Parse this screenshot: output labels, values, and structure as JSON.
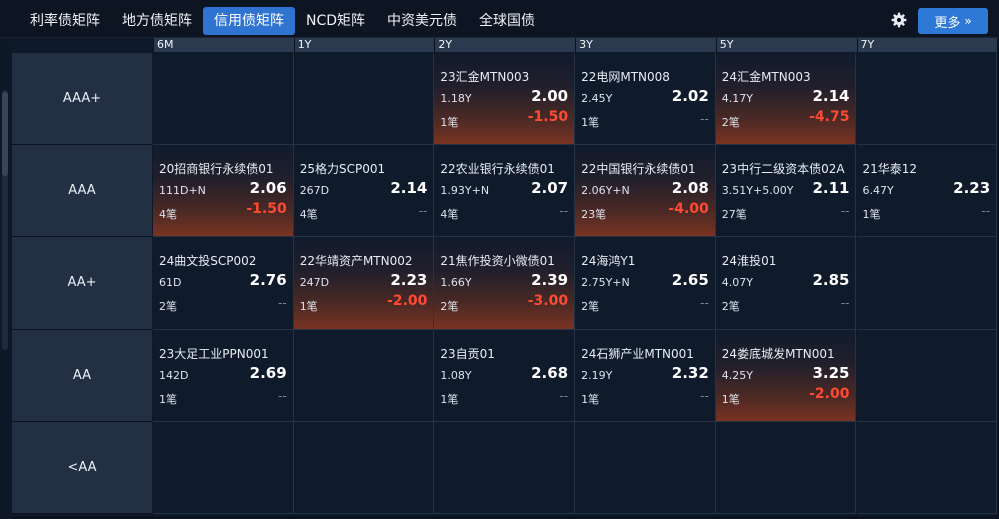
{
  "tabs": [
    {
      "label": "利率债矩阵",
      "active": false
    },
    {
      "label": "地方债矩阵",
      "active": false
    },
    {
      "label": "信用债矩阵",
      "active": true
    },
    {
      "label": "NCD矩阵",
      "active": false
    },
    {
      "label": "中资美元债",
      "active": false
    },
    {
      "label": "全球国债",
      "active": false
    }
  ],
  "toolbar": {
    "settings_icon": "gear-icon",
    "more_label": "更多",
    "more_icon": "double-chevron-right-icon"
  },
  "colors": {
    "accent": "#2f74d0",
    "negative": "#ff4a33",
    "neutral": "#7a8598",
    "row_header_bg": "#233044",
    "cell_bg": "#0f1a2b"
  },
  "matrix": {
    "columns": [
      "6M",
      "1Y",
      "2Y",
      "3Y",
      "5Y",
      "7Y"
    ],
    "rows": [
      {
        "rating": "AAA+",
        "cells": [
          null,
          null,
          {
            "name": "23汇金MTN003",
            "tenor": "1.18Y",
            "yield": "2.00",
            "count": "1笔",
            "change": "-1.50",
            "negative": true
          },
          {
            "name": "22电网MTN008",
            "tenor": "2.45Y",
            "yield": "2.02",
            "count": "1笔",
            "change": "--",
            "negative": false
          },
          {
            "name": "24汇金MTN003",
            "tenor": "4.17Y",
            "yield": "2.14",
            "count": "2笔",
            "change": "-4.75",
            "negative": true
          },
          null
        ]
      },
      {
        "rating": "AAA",
        "cells": [
          {
            "name": "20招商银行永续债01",
            "tenor": "111D+N",
            "yield": "2.06",
            "count": "4笔",
            "change": "-1.50",
            "negative": true
          },
          {
            "name": "25格力SCP001",
            "tenor": "267D",
            "yield": "2.14",
            "count": "4笔",
            "change": "--",
            "negative": false
          },
          {
            "name": "22农业银行永续债01",
            "tenor": "1.93Y+N",
            "yield": "2.07",
            "count": "4笔",
            "change": "--",
            "negative": false
          },
          {
            "name": "22中国银行永续债01",
            "tenor": "2.06Y+N",
            "yield": "2.08",
            "count": "23笔",
            "change": "-4.00",
            "negative": true
          },
          {
            "name": "23中行二级资本债02A",
            "tenor": "3.51Y+5.00Y",
            "yield": "2.11",
            "count": "27笔",
            "change": "--",
            "negative": false
          },
          {
            "name": "21华泰12",
            "tenor": "6.47Y",
            "yield": "2.23",
            "count": "1笔",
            "change": "--",
            "negative": false
          }
        ]
      },
      {
        "rating": "AA+",
        "cells": [
          {
            "name": "24曲文投SCP002",
            "tenor": "61D",
            "yield": "2.76",
            "count": "2笔",
            "change": "--",
            "negative": false
          },
          {
            "name": "22华靖资产MTN002",
            "tenor": "247D",
            "yield": "2.23",
            "count": "1笔",
            "change": "-2.00",
            "negative": true
          },
          {
            "name": "21焦作投资小微债01",
            "tenor": "1.66Y",
            "yield": "2.39",
            "count": "2笔",
            "change": "-3.00",
            "negative": true
          },
          {
            "name": "24海鸿Y1",
            "tenor": "2.75Y+N",
            "yield": "2.65",
            "count": "2笔",
            "change": "--",
            "negative": false
          },
          {
            "name": "24淮投01",
            "tenor": "4.07Y",
            "yield": "2.85",
            "count": "2笔",
            "change": "--",
            "negative": false
          },
          null
        ]
      },
      {
        "rating": "AA",
        "cells": [
          {
            "name": "23大足工业PPN001",
            "tenor": "142D",
            "yield": "2.69",
            "count": "1笔",
            "change": "--",
            "negative": false
          },
          null,
          {
            "name": "23自贡01",
            "tenor": "1.08Y",
            "yield": "2.68",
            "count": "1笔",
            "change": "--",
            "negative": false
          },
          {
            "name": "24石狮产业MTN001",
            "tenor": "2.19Y",
            "yield": "2.32",
            "count": "1笔",
            "change": "--",
            "negative": false
          },
          {
            "name": "24娄底城发MTN001",
            "tenor": "4.25Y",
            "yield": "3.25",
            "count": "1笔",
            "change": "-2.00",
            "negative": true
          },
          null
        ]
      },
      {
        "rating": "<AA",
        "cells": [
          null,
          null,
          null,
          null,
          null,
          null
        ]
      }
    ]
  }
}
